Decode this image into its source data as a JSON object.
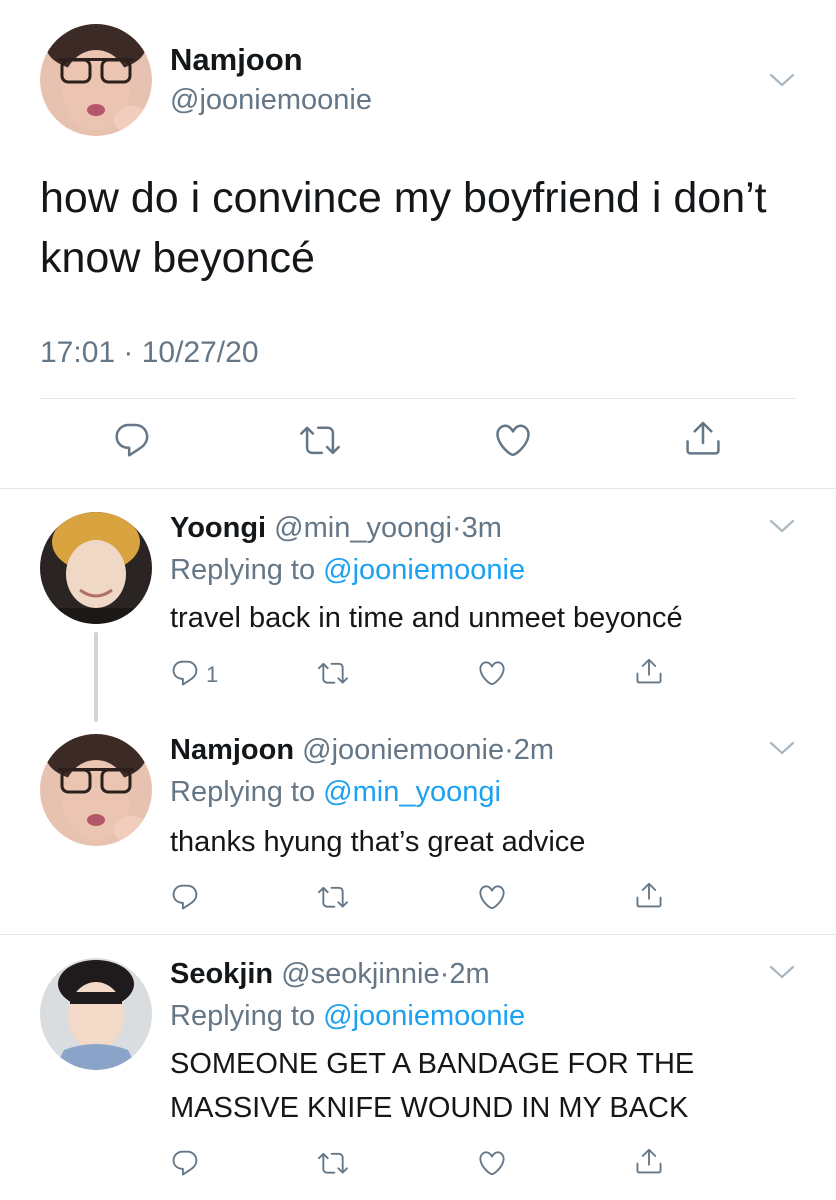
{
  "main": {
    "name": "Namjoon",
    "handle": "@jooniemoonie",
    "text_line1": "how do i convince my boyfriend i don’t",
    "text_line2": "know beyoncé",
    "timestamp": "17:01 · 10/27/20",
    "avatar_icon": "avatar-photo",
    "actions": [
      "reply-icon",
      "retweet-icon",
      "like-icon",
      "share-icon"
    ]
  },
  "replies": [
    {
      "name": "Yoongi",
      "handle": "@min_yoongi",
      "sep": "·",
      "time": "3m",
      "replying_prefix": "Replying to",
      "replying_to": "@jooniemoonie",
      "text_line1": "travel back in time and unmeet beyoncé",
      "reply_count": "1"
    },
    {
      "name": "Namjoon",
      "handle": "@jooniemoonie",
      "sep": "·",
      "time": "2m",
      "replying_prefix": "Replying to",
      "replying_to": "@min_yoongi",
      "text_line1": "thanks hyung that’s great advice"
    },
    {
      "name": "Seokjin",
      "handle": "@seokjinnie",
      "sep": "·",
      "time": "2m",
      "replying_prefix": "Replying to",
      "replying_to": "@jooniemoonie",
      "text_line1": "SOMEONE GET A BANDAGE FOR THE",
      "text_line2": "MASSIVE KNIFE WOUND IN MY BACK"
    }
  ],
  "colors": {
    "link": "#1da1f2",
    "secondary": "#657786",
    "divider": "#e1e8ed"
  }
}
